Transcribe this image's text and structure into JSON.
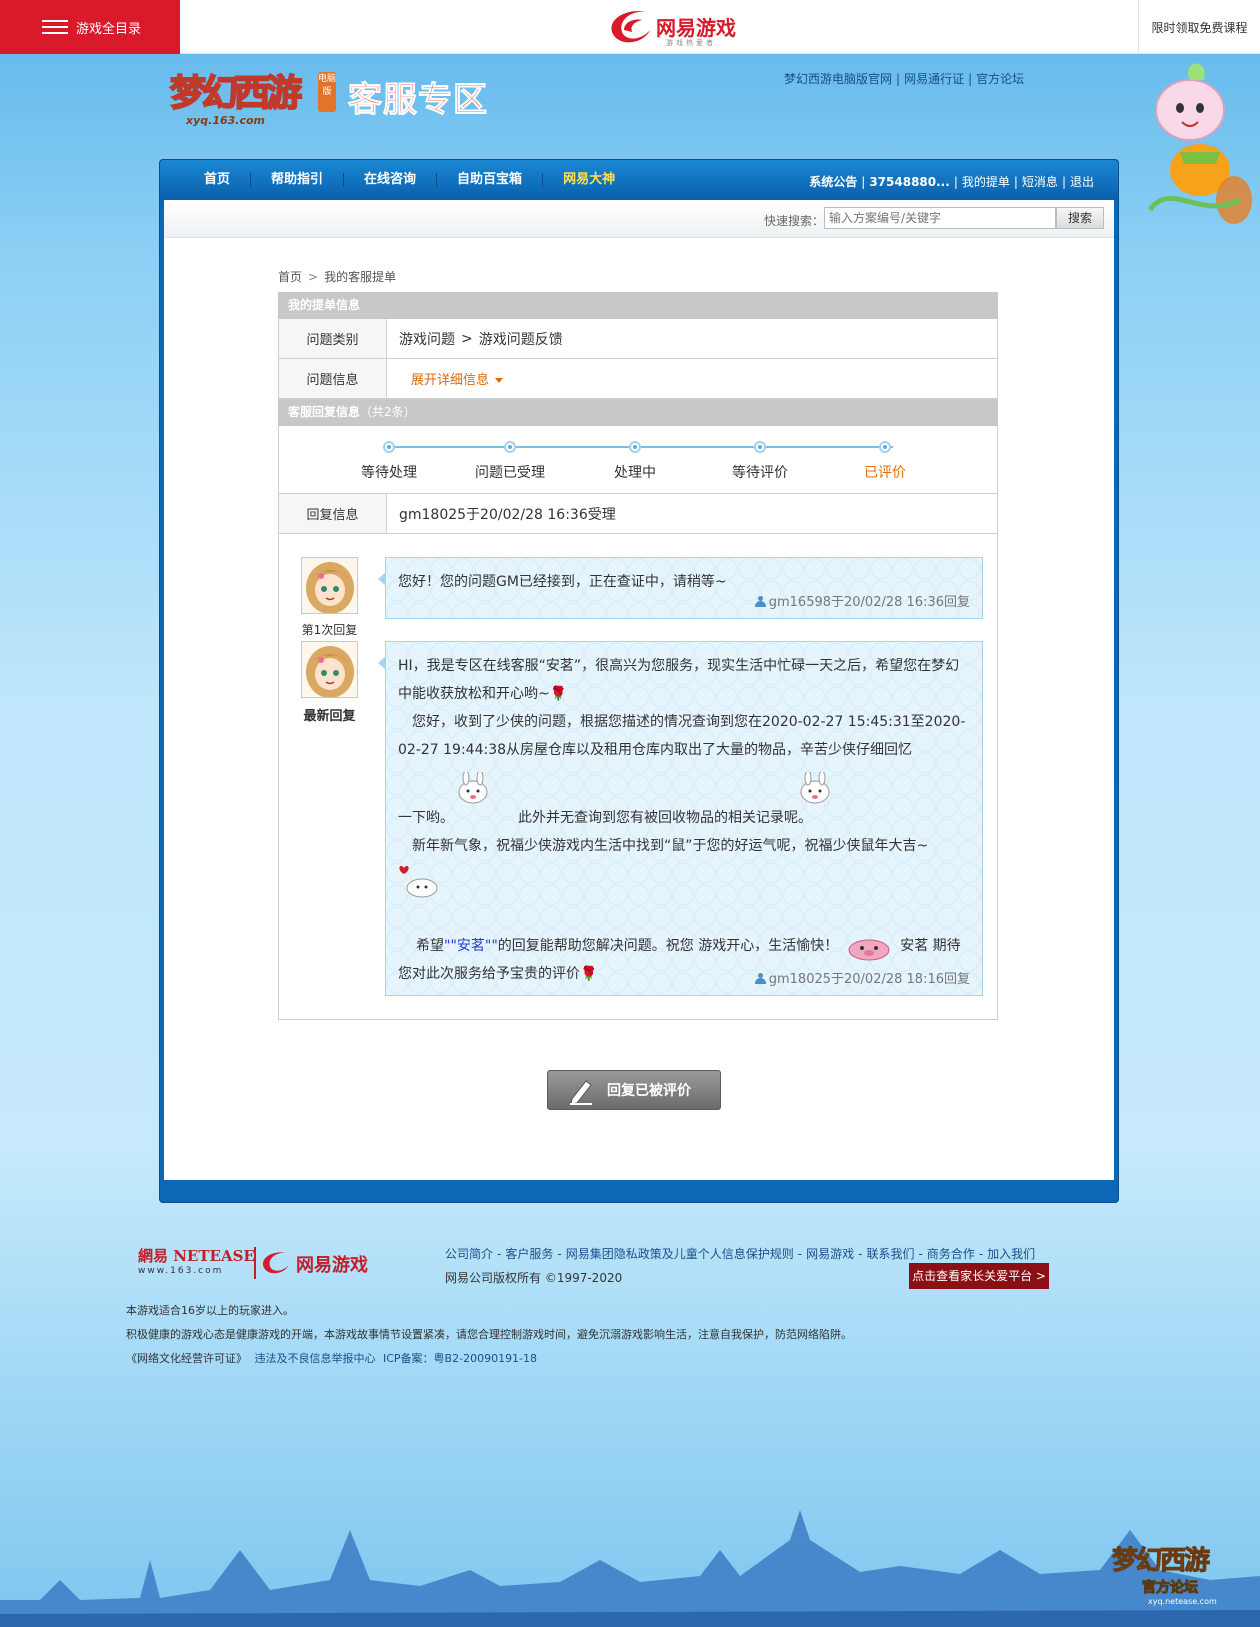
{
  "topbar": {
    "all_games": "游戏全目录",
    "brand_name": "网易游戏",
    "brand_sub": "游戏热爱者",
    "promo": "限时领取免费课程"
  },
  "header": {
    "logo_text": "梦幻西游",
    "logo_badge": "电脑版",
    "logo_domain": "xyq.163.com",
    "title": "客服专区",
    "links": [
      "梦幻西游电脑版官网",
      "网易通行证",
      "官方论坛"
    ]
  },
  "nav": {
    "items": [
      "首页",
      "帮助指引",
      "在线咨询",
      "自助百宝箱",
      "网易大神"
    ],
    "right": {
      "notice": "系统公告",
      "account": "37548880...",
      "my_tickets": "我的提单",
      "messages": "短消息",
      "logout": "退出"
    }
  },
  "search": {
    "label": "快速搜索：",
    "placeholder": "输入方案编号/关键字",
    "button": "搜索"
  },
  "breadcrumb": [
    "首页",
    "我的客服提单"
  ],
  "ticket": {
    "section_title": "我的提单信息",
    "category_label": "问题类别",
    "category": [
      "游戏问题",
      "游戏问题反馈"
    ],
    "info_label": "问题信息",
    "expand": "展开详细信息"
  },
  "reply_section": {
    "title": "客服回复信息",
    "count": "（共2条）",
    "steps": [
      "等待处理",
      "问题已受理",
      "处理中",
      "等待评价",
      "已评价"
    ],
    "active_step": 4,
    "reply_label": "回复信息",
    "reply_value": "gm18025于20/02/28 16:36受理"
  },
  "replies": [
    {
      "label": "第1次回复",
      "text": "您好！您的问题GM已经接到，正在查证中，请稍等~",
      "meta": "gm16598于20/02/28 16:36回复"
    },
    {
      "label": "最新回复",
      "p1a": "HI，我是专区在线客服“安茗”，很高兴为您服务，现实生活中忙碌一天之后，希望您在梦幻中能收获放松和开心哟~",
      "p2a": "您好，收到了少侠的问题，根据您描述的情况查询到您在2020-02-27 15:45:31至2020-02-27 19:44:38从房屋仓库以及租用仓库内取出了大量的物品，辛苦少侠仔细回忆",
      "p2b": "一下哟。",
      "p2c": "此外并无查询到您有被回收物品的相关记录呢。",
      "p3": "新年新气象，祝福少侠游戏内生活中找到“鼠”于您的好运气呢，祝福少侠鼠年大吉~",
      "p4a": "希望",
      "p4name": "\"\"安茗\"\"",
      "p4b": "的回复能帮助您解决问题。祝您 游戏开心，生活愉快！",
      "p4c": "安茗 期待",
      "p5": "您对此次服务给予宝贵的评价",
      "meta": "gm18025于20/02/28 18:16回复"
    }
  ],
  "rated_button": "回复已被评价",
  "footer": {
    "netease_logo": "網易 NETEASE",
    "netease_sub": "www.163.com",
    "games_logo": "网易游戏",
    "links": [
      "公司简介",
      "客户服务",
      "网易集团隐私政策及儿童个人信息保护规则",
      "网易游戏",
      "联系我们",
      "商务合作",
      "加入我们"
    ],
    "copyright": "网易公司版权所有 ©1997-2020",
    "parent_btn": "点击查看家长关爱平台 >",
    "line1": "本游戏适合16岁以上的玩家进入。",
    "line2": "积极健康的游戏心态是健康游戏的开端，本游戏故事情节设置紧凑，请您合理控制游戏时间，避免沉溺游戏影响生活，注意自我保护，防范网络陷阱。",
    "line3a": "《网络文化经营许可证》",
    "line3b": "违法及不良信息举报中心",
    "line3c": "ICP备案：粤B2-20090191-18",
    "corner_logo": "梦幻西游",
    "corner_sub": "官方论坛",
    "corner_domain": "xyq.netease.com"
  },
  "colors": {
    "brand_red": "#d91a2a",
    "nav_blue": "#0a5fac",
    "active_orange": "#e06f0c",
    "link_blue": "#1a4f8a"
  }
}
